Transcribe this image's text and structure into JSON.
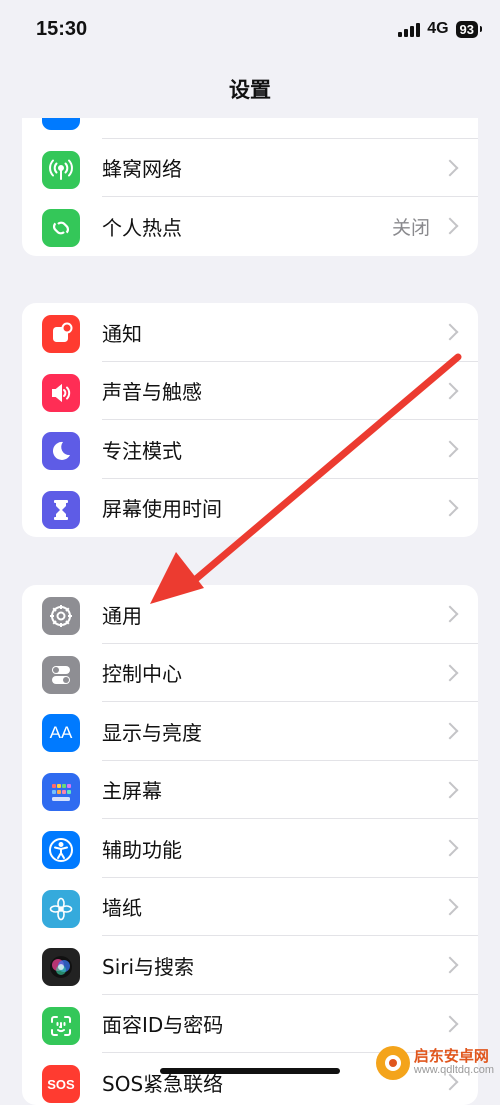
{
  "status_bar": {
    "time": "15:30",
    "network": "4G",
    "battery": "93"
  },
  "nav": {
    "title": "设置"
  },
  "groups": [
    {
      "items": [
        {
          "label": "蜂窝网络",
          "icon": "cellular-icon",
          "color": "#34c759",
          "value": ""
        },
        {
          "label": "个人热点",
          "icon": "hotspot-icon",
          "color": "#34c759",
          "value": "关闭"
        }
      ]
    },
    {
      "items": [
        {
          "label": "通知",
          "icon": "notifications-icon",
          "color": "#ff3b30"
        },
        {
          "label": "声音与触感",
          "icon": "sound-icon",
          "color": "#ff2d55"
        },
        {
          "label": "专注模式",
          "icon": "focus-moon-icon",
          "color": "#5e5ce6"
        },
        {
          "label": "屏幕使用时间",
          "icon": "screentime-hourglass-icon",
          "color": "#5e5ce6"
        }
      ]
    },
    {
      "items": [
        {
          "label": "通用",
          "icon": "gear-icon",
          "color": "#8e8e93"
        },
        {
          "label": "控制中心",
          "icon": "toggles-icon",
          "color": "#8e8e93"
        },
        {
          "label": "显示与亮度",
          "icon": "display-aa-icon",
          "color": "#007aff"
        },
        {
          "label": "主屏幕",
          "icon": "home-screen-grid-icon",
          "color": "#2f6bf0"
        },
        {
          "label": "辅助功能",
          "icon": "accessibility-icon",
          "color": "#007aff"
        },
        {
          "label": "墙纸",
          "icon": "wallpaper-flower-icon",
          "color": "#35aadc"
        },
        {
          "label": "Siri与搜索",
          "icon": "siri-icon",
          "color": "#222222"
        },
        {
          "label": "面容ID与密码",
          "icon": "face-id-icon",
          "color": "#34c759"
        },
        {
          "label": "SOS紧急联络",
          "icon": "sos-icon",
          "color": "#ff3b30"
        }
      ]
    }
  ],
  "watermark": {
    "name": "启东安卓网",
    "url": "www.qdltdq.com"
  },
  "annotation": {
    "color": "#ec3b30"
  }
}
